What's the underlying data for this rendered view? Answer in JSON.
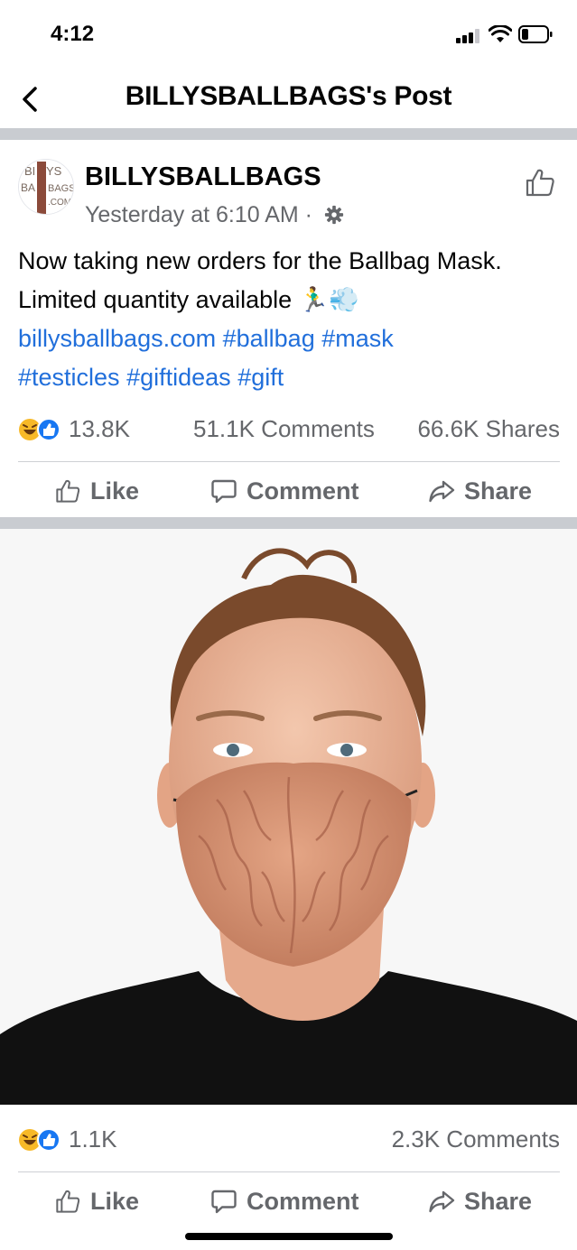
{
  "status_bar": {
    "time": "4:12"
  },
  "nav": {
    "title": "BILLYSBALLBAGS's Post"
  },
  "post": {
    "page_name": "BILLYSBALLBAGS",
    "timestamp": "Yesterday at 6:10 AM · ",
    "avatar_logo_text": "BILLYS BALLBAGS .COM",
    "text_line1": "Now taking new orders for the Ballbag Mask.",
    "text_line2": "Limited quantity available 🏃‍♂️💨",
    "link": "billysballbags.com",
    "hashtags": [
      "#ballbag",
      "#mask",
      "#testicles",
      "#giftideas",
      "#gift"
    ],
    "reactions": "13.8K",
    "comments": "51.1K Comments",
    "shares": "66.6K Shares"
  },
  "actions": {
    "like": "Like",
    "comment": "Comment",
    "share": "Share"
  },
  "photo": {
    "reactions": "1.1K",
    "comments": "2.3K Comments"
  },
  "icons": {
    "back": "chevron-left-icon",
    "like": "thumbs-up-icon",
    "comment": "comment-bubble-icon",
    "share": "share-arrow-icon",
    "gear": "gear-icon",
    "reaction_haha": "haha-reaction-icon",
    "reaction_like": "like-reaction-icon"
  },
  "colors": {
    "link": "#216fdb",
    "secondary_text": "#65676b",
    "divider": "#c9ccd1",
    "reaction_blue": "#1877f2",
    "reaction_yellow": "#f7b928"
  }
}
